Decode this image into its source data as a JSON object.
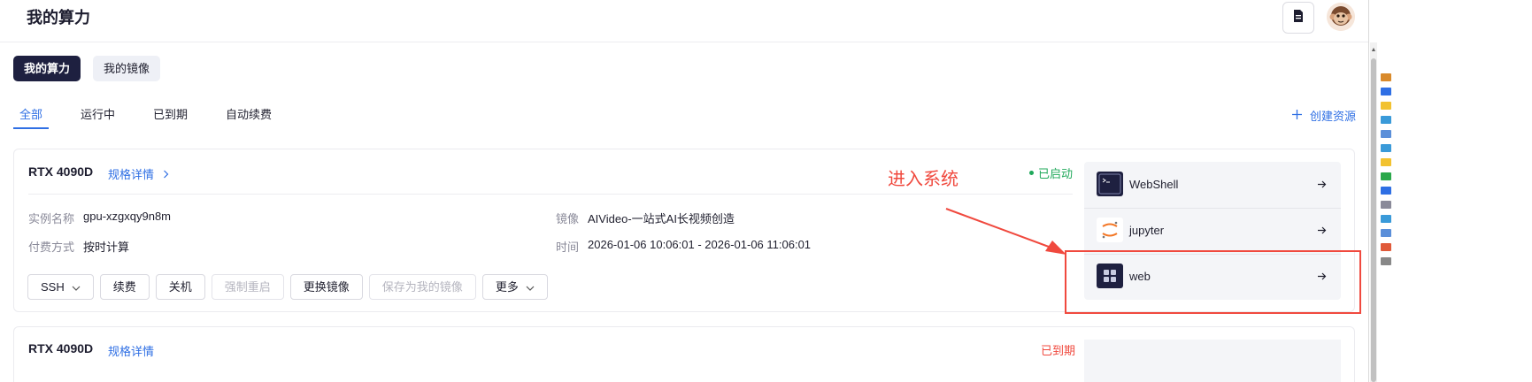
{
  "header": {
    "title": "我的算力",
    "doc_icon": "document-icon",
    "avatar_icon": "monkey-avatar"
  },
  "subtabs": [
    {
      "label": "我的算力",
      "active": true
    },
    {
      "label": "我的镜像",
      "active": false
    }
  ],
  "filter_tabs": [
    {
      "label": "全部",
      "active": true
    },
    {
      "label": "运行中",
      "active": false
    },
    {
      "label": "已到期",
      "active": false
    },
    {
      "label": "自动续费",
      "active": false
    }
  ],
  "create_resource": {
    "icon": "plus-icon",
    "label": "创建资源"
  },
  "instance": {
    "gpu": "RTX 4090D",
    "spec_link": "规格详情",
    "status": "已启动",
    "status_color": "#1fa85a",
    "instance_name_label": "实例名称",
    "instance_name": "gpu-xzgxqy9n8m",
    "billing_label": "付费方式",
    "billing": "按时计算",
    "image_label": "镜像",
    "image": "AIVideo-一站式AI长视频创造",
    "time_label": "时间",
    "time": "2026-01-06 10:06:01 - 2026-01-06 11:06:01",
    "actions": [
      {
        "label": "SSH",
        "dropdown": true,
        "disabled": false
      },
      {
        "label": "续费",
        "dropdown": false,
        "disabled": false
      },
      {
        "label": "关机",
        "dropdown": false,
        "disabled": false
      },
      {
        "label": "强制重启",
        "dropdown": false,
        "disabled": true
      },
      {
        "label": "更换镜像",
        "dropdown": false,
        "disabled": false
      },
      {
        "label": "保存为我的镜像",
        "dropdown": false,
        "disabled": true
      },
      {
        "label": "更多",
        "dropdown": true,
        "disabled": false
      }
    ],
    "access": [
      {
        "label": "WebShell",
        "icon": "terminal-icon"
      },
      {
        "label": "jupyter",
        "icon": "jupyter-icon"
      },
      {
        "label": "web",
        "icon": "web-grid-icon"
      }
    ]
  },
  "annotation": {
    "text": "进入系统",
    "color": "#f0493e"
  },
  "instance2": {
    "gpu": "RTX 4090D",
    "spec_link": "规格详情",
    "status": "已到期"
  },
  "colors": {
    "accent": "#2f6fe4",
    "dark": "#1e2040",
    "success": "#1fa85a",
    "annotation": "#f0493e"
  }
}
